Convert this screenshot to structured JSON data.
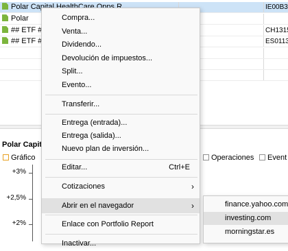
{
  "table": {
    "rows": [
      {
        "name": "Polar Capital HealthCare Opps R",
        "isin": "IE00B3I",
        "selected": true
      },
      {
        "name": "Polar",
        "isin": "",
        "selected": false
      },
      {
        "name": "## ETF #",
        "isin": "CH1315",
        "selected": false
      },
      {
        "name": "## ETF #",
        "isin": "ES0113",
        "selected": false
      }
    ]
  },
  "lower_panel": {
    "title": "Polar Capit",
    "tabs": {
      "grafico": "Gráfico",
      "operaciones": "Operaciones",
      "eventos": "Event"
    },
    "y_labels": [
      "+3%",
      "+2,5%",
      "+2%"
    ]
  },
  "context_menu": {
    "compra": "Compra...",
    "venta": "Venta...",
    "dividendo": "Dividendo...",
    "devolucion": "Devolución de impuestos...",
    "split": "Split...",
    "evento": "Evento...",
    "transferir": "Transferir...",
    "entrega_entrada": "Entrega (entrada)...",
    "entrega_salida": "Entrega (salida)...",
    "nuevo_plan": "Nuevo plan de inversión...",
    "editar": "Editar...",
    "editar_shortcut": "Ctrl+E",
    "cotizaciones": "Cotizaciones",
    "abrir_navegador": "Abrir en el navegador",
    "enlace": "Enlace con Portfolio Report",
    "last_partial": "Inactivar..."
  },
  "submenu": {
    "items": [
      "finance.yahoo.com",
      "investing.com",
      "morningstar.es"
    ]
  }
}
